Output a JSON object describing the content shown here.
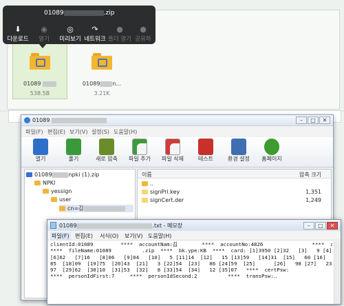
{
  "toolbar_dark": {
    "title": "01089",
    "title_suffix": ".zip",
    "buttons": [
      {
        "label": "다운로드",
        "icon": "download-icon",
        "glyph": "⬇",
        "enabled": true
      },
      {
        "label": "열기",
        "icon": "open-icon",
        "glyph": "◉",
        "enabled": false
      },
      {
        "label": "미리보기",
        "icon": "eye-icon",
        "glyph": "◎",
        "enabled": true
      },
      {
        "label": "네트워크",
        "icon": "share-icon",
        "glyph": "↷",
        "enabled": true
      },
      {
        "label": "폴더 열기",
        "icon": "folder-open-icon",
        "glyph": "●",
        "enabled": false
      },
      {
        "label": "공유하",
        "icon": "share-more-icon",
        "glyph": "●",
        "enabled": false
      }
    ]
  },
  "files": [
    {
      "name": "01089",
      "name_suffix": "",
      "size": "538.5B"
    },
    {
      "name": "01089",
      "name_suffix": "n...",
      "size": "3.21K"
    }
  ],
  "zip_window": {
    "title": "01089",
    "controls": [
      "–",
      "□",
      "✕"
    ],
    "menu": [
      "파일(F)",
      "편집(E)",
      "보기(V)",
      "설정(S)",
      "도움말(H)"
    ],
    "tools": [
      {
        "label": "열기",
        "icon": "open-archive-icon",
        "color": "#2f6fc9"
      },
      {
        "label": "풀기",
        "icon": "extract-icon",
        "color": "#3a9a3a"
      },
      {
        "label": "새로 압축",
        "icon": "new-archive-icon",
        "color": "#6a8c2a"
      },
      {
        "label": "파일 추가",
        "icon": "add-file-icon",
        "color": "#3b9b3b"
      },
      {
        "label": "파일 삭제",
        "icon": "delete-file-icon",
        "color": "#d23b3b"
      },
      {
        "label": "테스트",
        "icon": "test-icon",
        "color": "#c8312a"
      },
      {
        "label": "환경 설정",
        "icon": "settings-icon",
        "color": "#3f6fb0"
      },
      {
        "label": "홈페이지",
        "icon": "homepage-icon",
        "color": "#3c9c2c"
      }
    ],
    "tree": [
      {
        "label": "01089",
        "suffix": "npki (1).zip",
        "level": 0
      },
      {
        "label": "NPKI",
        "suffix": "",
        "level": 1
      },
      {
        "label": "yessign",
        "suffix": "",
        "level": 2
      },
      {
        "label": "user",
        "suffix": "",
        "level": 3
      },
      {
        "label": "cn=김",
        "suffix": "",
        "level": 4
      }
    ],
    "columns": {
      "name": "이름",
      "size": "압축 크기"
    },
    "rows": [
      {
        "name": "..",
        "size": ""
      },
      {
        "name": "signPri.key",
        "size": "1,351"
      },
      {
        "name": "signCert.der",
        "size": "1,249"
      }
    ]
  },
  "notepad": {
    "title_prefix": "01089",
    "title_suffix": ".txt - 메모장",
    "menu": [
      "파일(F)",
      "편집(E)",
      "서식(O)",
      "보기(V)",
      "도움말(H)"
    ],
    "lines": [
      "clientId:01089         ****  accountNam:김        ****  accountNo:4826                ****  accountPsw:09",
      "****  fileName:01089          .zip  ****  bk.ype:KB  ****  card: [1]3950 [2]32   [3]   9 [4]2     [5]50",
      "[6]62   [7]16   [8]06   [9]04   [10]   5 [11]14  [12]   15 [13]59   [14]31  [15]   60 [16]   40 [17]",
      "85  [18]09  [19]75  [20]43  [21]   3 [22]54  [23]   86 [24]59  [25]      [26]   98 [27]   23 [28]",
      "97  [29]62  [30]10  [31]53  [32]   8 [33]54  [34]   12 [35]07   ****  certPsw:",
      "****  personIdFirst:7     ****  personIdSecond:2          ****  transPsw:․․"
    ]
  }
}
